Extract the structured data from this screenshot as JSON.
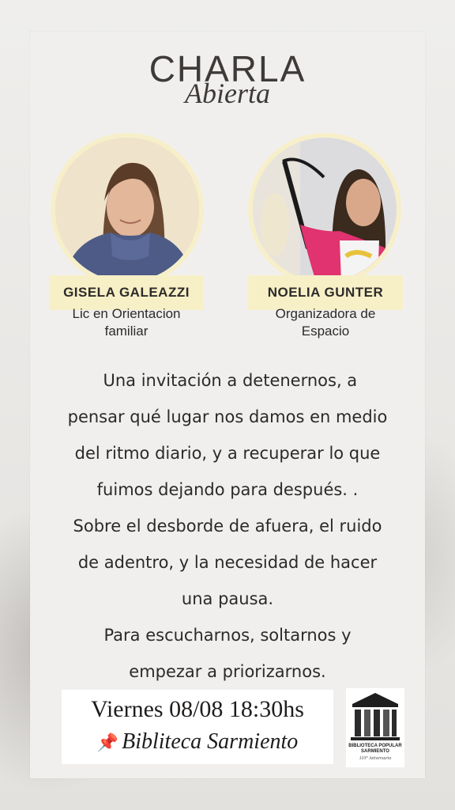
{
  "header": {
    "title": "CHARLA",
    "subtitle": "Abierta"
  },
  "speakers": [
    {
      "name": "GISELA GALEAZZI",
      "role_line1": "Lic en Orientacion",
      "role_line2": "familiar",
      "avatar_icon": "portrait-woman-blue-sweater"
    },
    {
      "name": "NOELIA GUNTER",
      "role_line1": "Organizadora de",
      "role_line2": "Espacio",
      "avatar_icon": "portrait-woman-pink-cardigan"
    }
  ],
  "description": {
    "lines": [
      " Una invitación a detenernos, a",
      "pensar qué lugar nos damos en medio",
      "del ritmo diario, y a recuperar lo que",
      "fuimos dejando para después. .",
      "Sobre el desborde de afuera, el ruido",
      "de adentro, y la necesidad de hacer",
      "una pausa.",
      "Para escucharnos, soltarnos y",
      "empezar a priorizarnos."
    ]
  },
  "event": {
    "date_time": "Viernes 08/08 18:30hs",
    "place_icon": "pushpin-icon",
    "place": "Bibliteca Sarmiento"
  },
  "logo": {
    "line1": "BIBLIOTECA POPULAR",
    "line2": "SARMIENTO",
    "anniversary": "110° Aniversario"
  },
  "colors": {
    "card_bg": "#f1efee",
    "tag_bg": "#f7f0c7",
    "text": "#2b2a29",
    "pin": "#d23030"
  }
}
